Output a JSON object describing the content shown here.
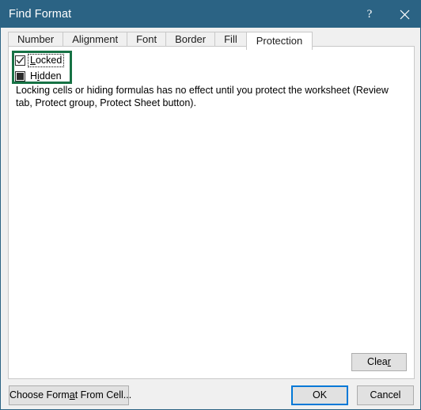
{
  "window": {
    "title": "Find Format",
    "help_icon": "question-mark-icon",
    "close_icon": "close-icon"
  },
  "tabs": [
    {
      "id": "number",
      "label": "Number",
      "active": false
    },
    {
      "id": "alignment",
      "label": "Alignment",
      "active": false
    },
    {
      "id": "font",
      "label": "Font",
      "active": false
    },
    {
      "id": "border",
      "label": "Border",
      "active": false
    },
    {
      "id": "fill",
      "label": "Fill",
      "active": false
    },
    {
      "id": "protection",
      "label": "Protection",
      "active": true
    }
  ],
  "protection": {
    "locked": {
      "label": "Locked",
      "accel_before": "L",
      "state": "checked",
      "focused": true
    },
    "hidden": {
      "label": "Hidden",
      "accel_letter": "i",
      "state": "mixed",
      "focused": false
    },
    "description": "Locking cells or hiding formulas has no effect until you protect the worksheet (Review tab, Protect group, Protect Sheet button).",
    "clear_label": "Clear",
    "clear_accel": "r"
  },
  "footer": {
    "choose_format_label": "Choose Format From Cell...",
    "choose_format_accel": "a",
    "ok_label": "OK",
    "cancel_label": "Cancel"
  },
  "colors": {
    "titlebar": "#2b6384",
    "highlight_green": "#177245",
    "focus_blue": "#0078d7",
    "panel_background": "#ffffff",
    "dialog_background": "#f0f0f0"
  }
}
